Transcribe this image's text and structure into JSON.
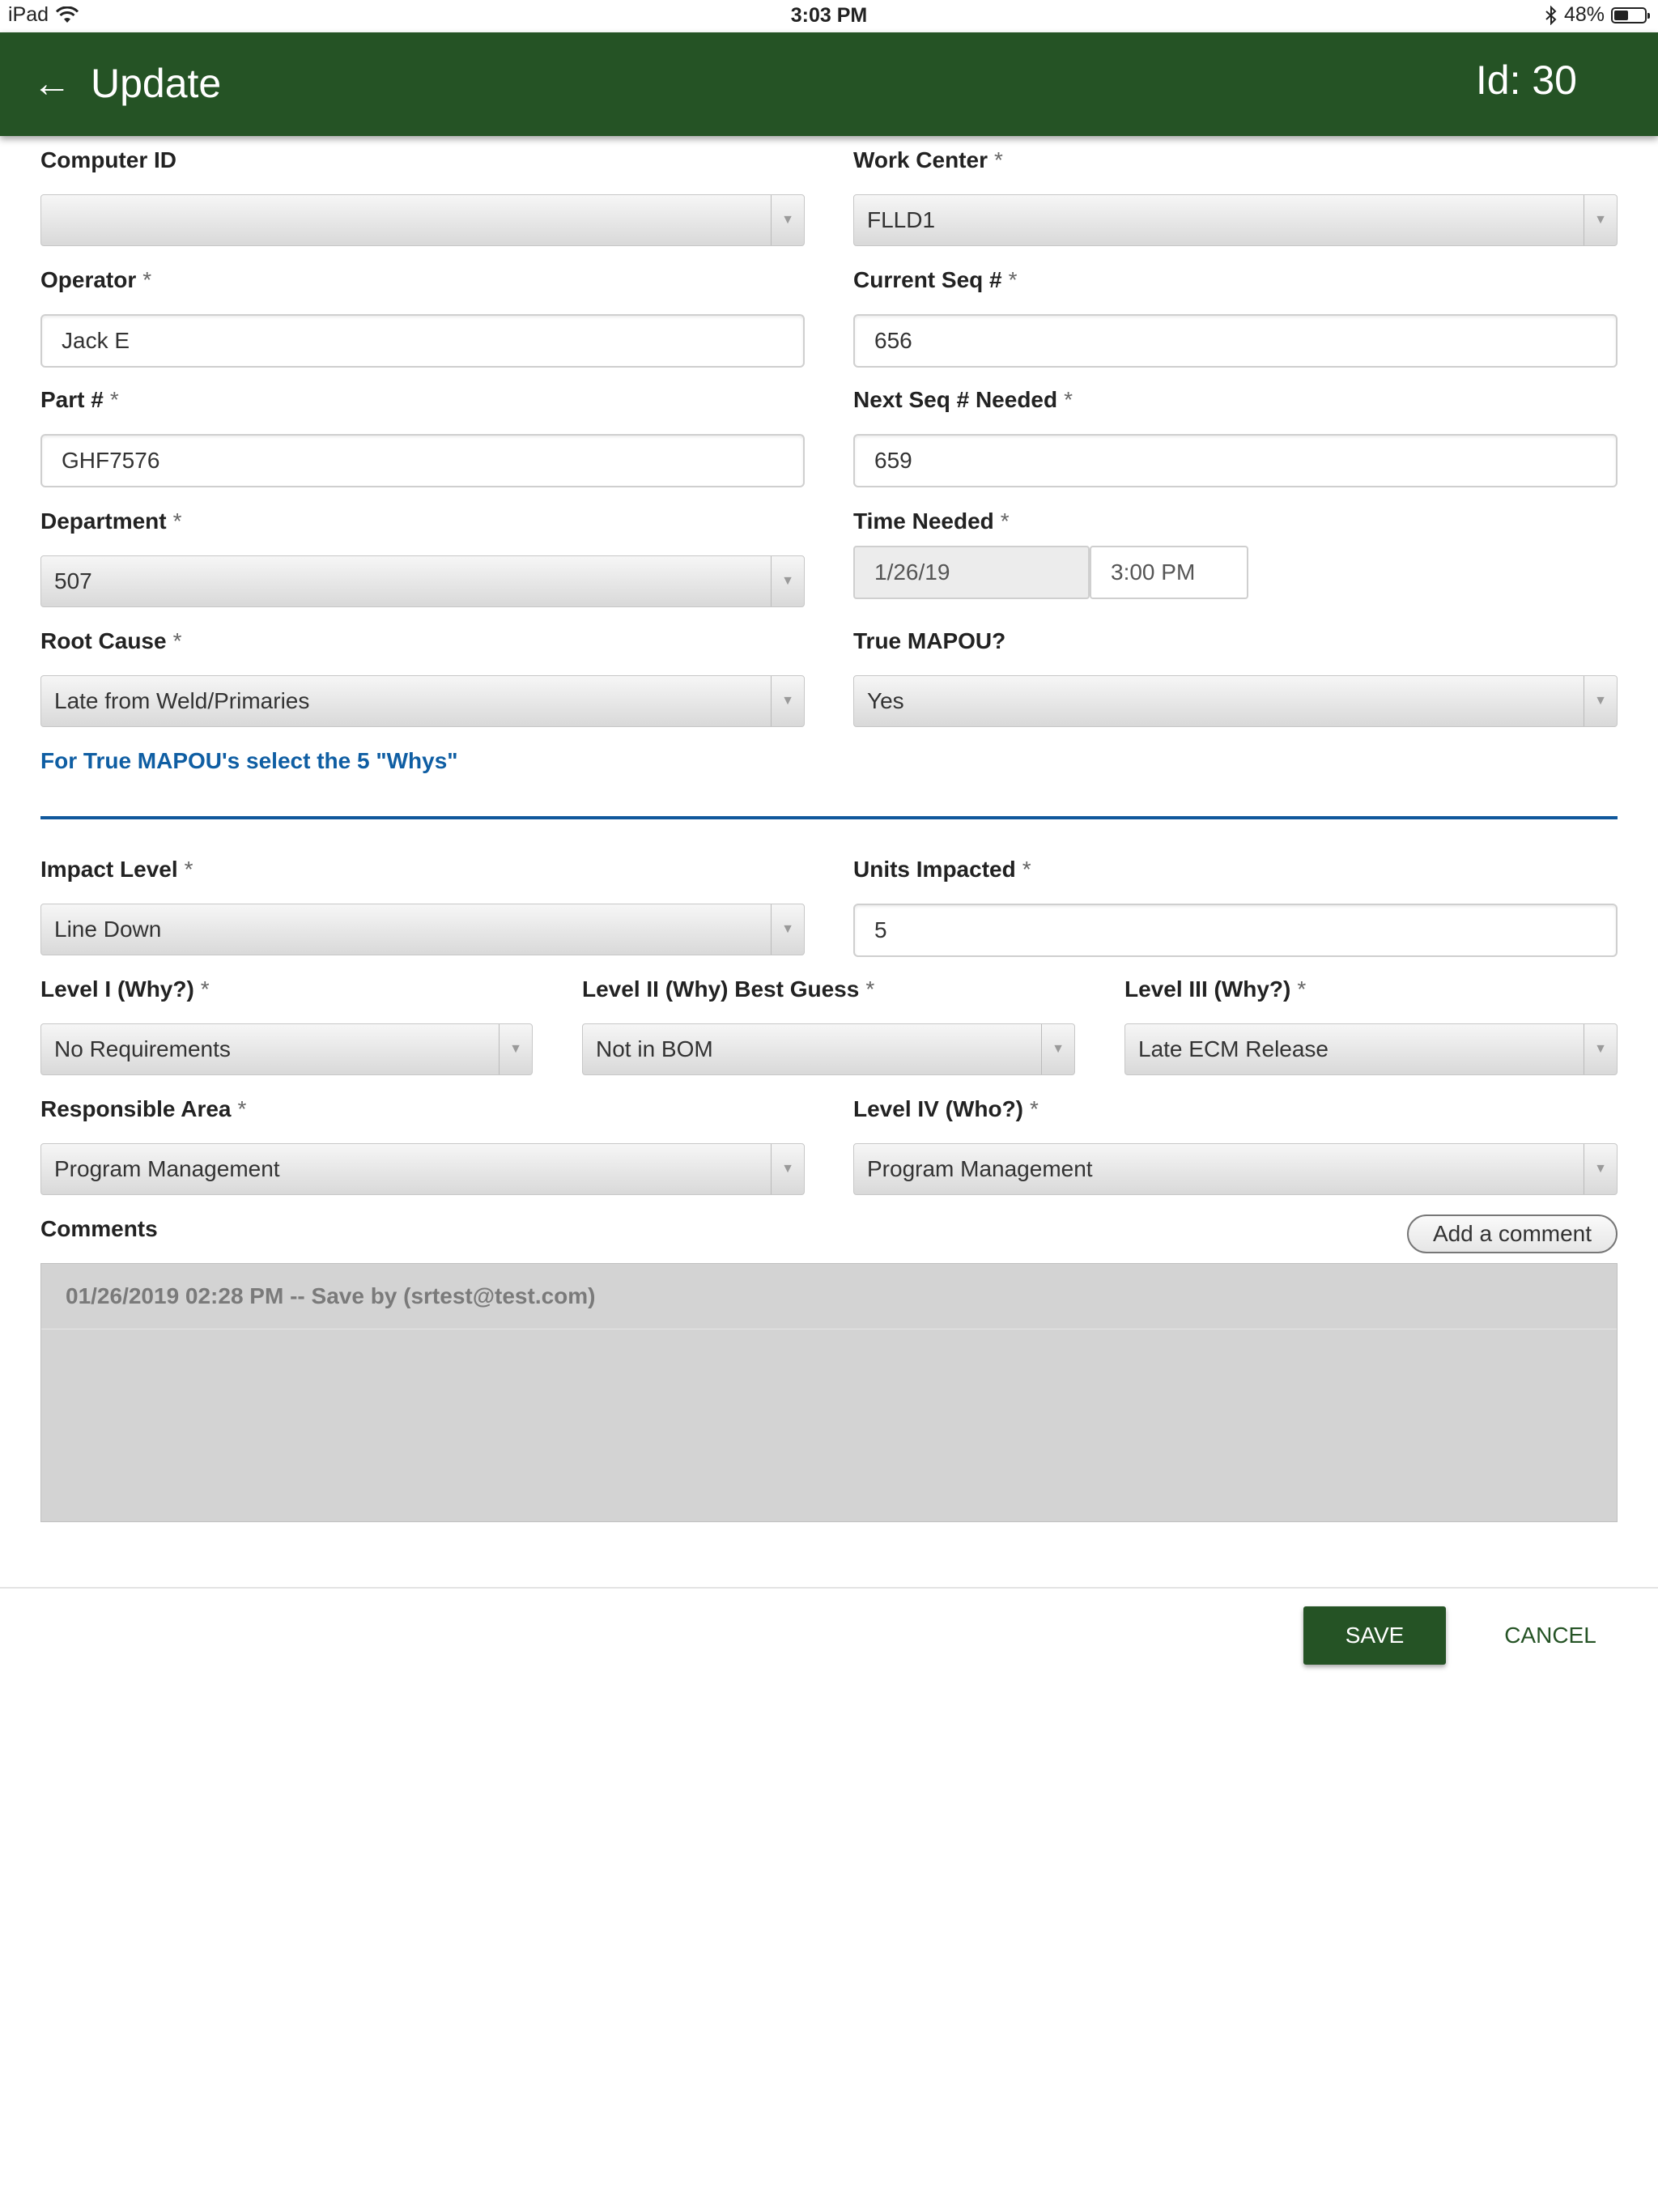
{
  "status_bar": {
    "device": "iPad",
    "time": "3:03 PM",
    "battery": "48%",
    "battery_level": 0.48
  },
  "header": {
    "title": "Update",
    "id_label": "Id: 30"
  },
  "form": {
    "computer_id": {
      "label": "Computer ID",
      "value": ""
    },
    "work_center": {
      "label": "Work Center",
      "value": "FLLD1"
    },
    "operator": {
      "label": "Operator",
      "value": "Jack E"
    },
    "current_seq": {
      "label": "Current Seq #",
      "value": "656"
    },
    "part": {
      "label": "Part #",
      "value": "GHF7576"
    },
    "next_seq": {
      "label": "Next Seq # Needed",
      "value": "659"
    },
    "department": {
      "label": "Department",
      "value": "507"
    },
    "time_needed": {
      "label": "Time Needed",
      "date": "1/26/19",
      "time": "3:00 PM"
    },
    "root_cause": {
      "label": "Root Cause",
      "value": "Late from Weld/Primaries"
    },
    "true_mapou": {
      "label": "True MAPOU?",
      "value": "Yes"
    },
    "why_instruction": "For True MAPOU's select the 5 \"Whys\"",
    "impact_level": {
      "label": "Impact Level",
      "value": "Line Down"
    },
    "units_impacted": {
      "label": "Units Impacted",
      "value": "5"
    },
    "level1": {
      "label": "Level I (Why?)",
      "value": "No Requirements"
    },
    "level2": {
      "label": "Level II (Why) Best Guess",
      "value": "Not in BOM"
    },
    "level3": {
      "label": "Level III (Why?)",
      "value": "Late ECM Release"
    },
    "responsible_area": {
      "label": "Responsible Area",
      "value": "Program Management"
    },
    "level4": {
      "label": "Level IV (Who?)",
      "value": "Program Management"
    },
    "required_marker": "*",
    "dropdown_arrow": "▼"
  },
  "comments": {
    "label": "Comments",
    "add_button": "Add a comment",
    "entries": [
      "01/26/2019 02:28 PM -- Save by (srtest@test.com)"
    ]
  },
  "actions": {
    "save": "SAVE",
    "cancel": "CANCEL"
  },
  "colors": {
    "header": "#255325",
    "link": "#0f5ea3",
    "divider": "#10589c"
  }
}
